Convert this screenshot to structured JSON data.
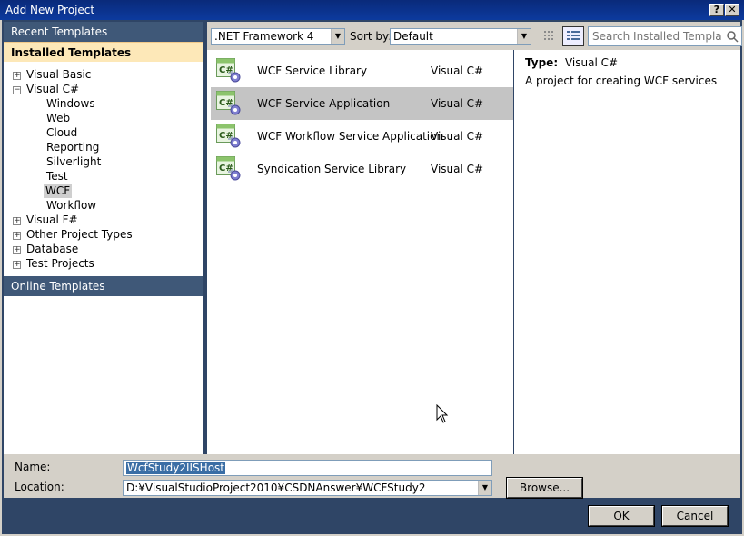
{
  "window": {
    "title": "Add New Project"
  },
  "left": {
    "recent": "Recent Templates",
    "installed": "Installed Templates",
    "online": "Online Templates",
    "tree": {
      "vb": "Visual Basic",
      "cs": "Visual C#",
      "windows": "Windows",
      "web": "Web",
      "cloud": "Cloud",
      "reporting": "Reporting",
      "silverlight": "Silverlight",
      "test": "Test",
      "wcf": "WCF",
      "workflow": "Workflow",
      "fs": "Visual F#",
      "other": "Other Project Types",
      "database": "Database",
      "testprojects": "Test Projects"
    }
  },
  "toolbar": {
    "framework": ".NET Framework 4",
    "sortby_label": "Sort by:",
    "sortby_value": "Default",
    "search_placeholder": "Search Installed Templates"
  },
  "templates": [
    {
      "name": "WCF Service Library",
      "lang": "Visual C#",
      "selected": false
    },
    {
      "name": "WCF Service Application",
      "lang": "Visual C#",
      "selected": true
    },
    {
      "name": "WCF Workflow Service Application",
      "lang": "Visual C#",
      "selected": false
    },
    {
      "name": "Syndication Service Library",
      "lang": "Visual C#",
      "selected": false
    }
  ],
  "details": {
    "type_label": "Type:",
    "type_value": "Visual C#",
    "description": "A project for creating WCF services"
  },
  "form": {
    "name_label": "Name:",
    "name_value": "WcfStudy2IISHost",
    "location_label": "Location:",
    "location_value": "D:¥VisualStudioProject2010¥CSDNAnswer¥WCFStudy2",
    "browse": "Browse...",
    "ok": "OK",
    "cancel": "Cancel"
  }
}
